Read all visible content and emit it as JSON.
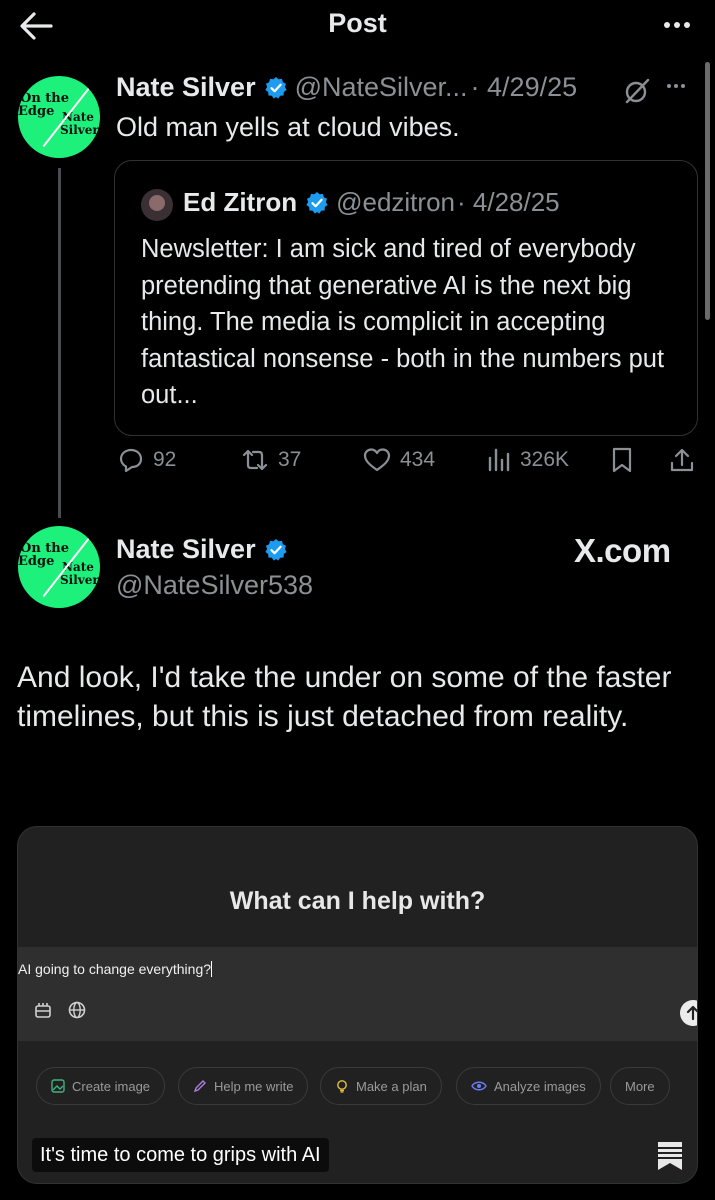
{
  "header": {
    "title": "Post"
  },
  "tweet1": {
    "author_name": "Nate Silver",
    "author_handle": "@NateSilver...",
    "date": "· 4/29/25",
    "text": "Old man yells at cloud vibes.",
    "avatar_text": [
      "On the",
      "Edge",
      "Nate",
      "Silver"
    ],
    "quote": {
      "author_name": "Ed Zitron",
      "author_handle": "@edzitron",
      "date": "· 4/28/25",
      "text": "Newsletter: I am sick and tired of everybody pretending that generative AI is the next big thing. The media is complicit in accepting fantastical nonsense - both in the numbers put out..."
    },
    "stats": {
      "replies": "92",
      "reposts": "37",
      "likes": "434",
      "views": "326K"
    }
  },
  "tweet2": {
    "author_name": "Nate Silver",
    "author_handle": "@NateSilver538",
    "watermark": "X.com",
    "text": "And look, I'd take the under on some of the faster timelines, but this is just detached from reality.",
    "avatar_text": [
      "On the",
      "Edge",
      "Nate",
      "Silver"
    ],
    "media": {
      "heading": "What can I help with?",
      "prompt": "AI going to change everything?",
      "chips": [
        "Create image",
        "Help me write",
        "Make a plan",
        "Analyze images",
        "More"
      ],
      "caption": "It's time to come to grips with AI"
    }
  },
  "colors": {
    "background": "#000000",
    "text": "#e7e9ea",
    "muted": "#8b9095",
    "verified": "#1d9bf0",
    "avatar": "#1df07b"
  },
  "icons": [
    "back-arrow-icon",
    "more-icon",
    "verified-icon",
    "edited-icon",
    "reply-icon",
    "repost-icon",
    "like-icon",
    "views-icon",
    "bookmark-icon",
    "share-icon"
  ]
}
